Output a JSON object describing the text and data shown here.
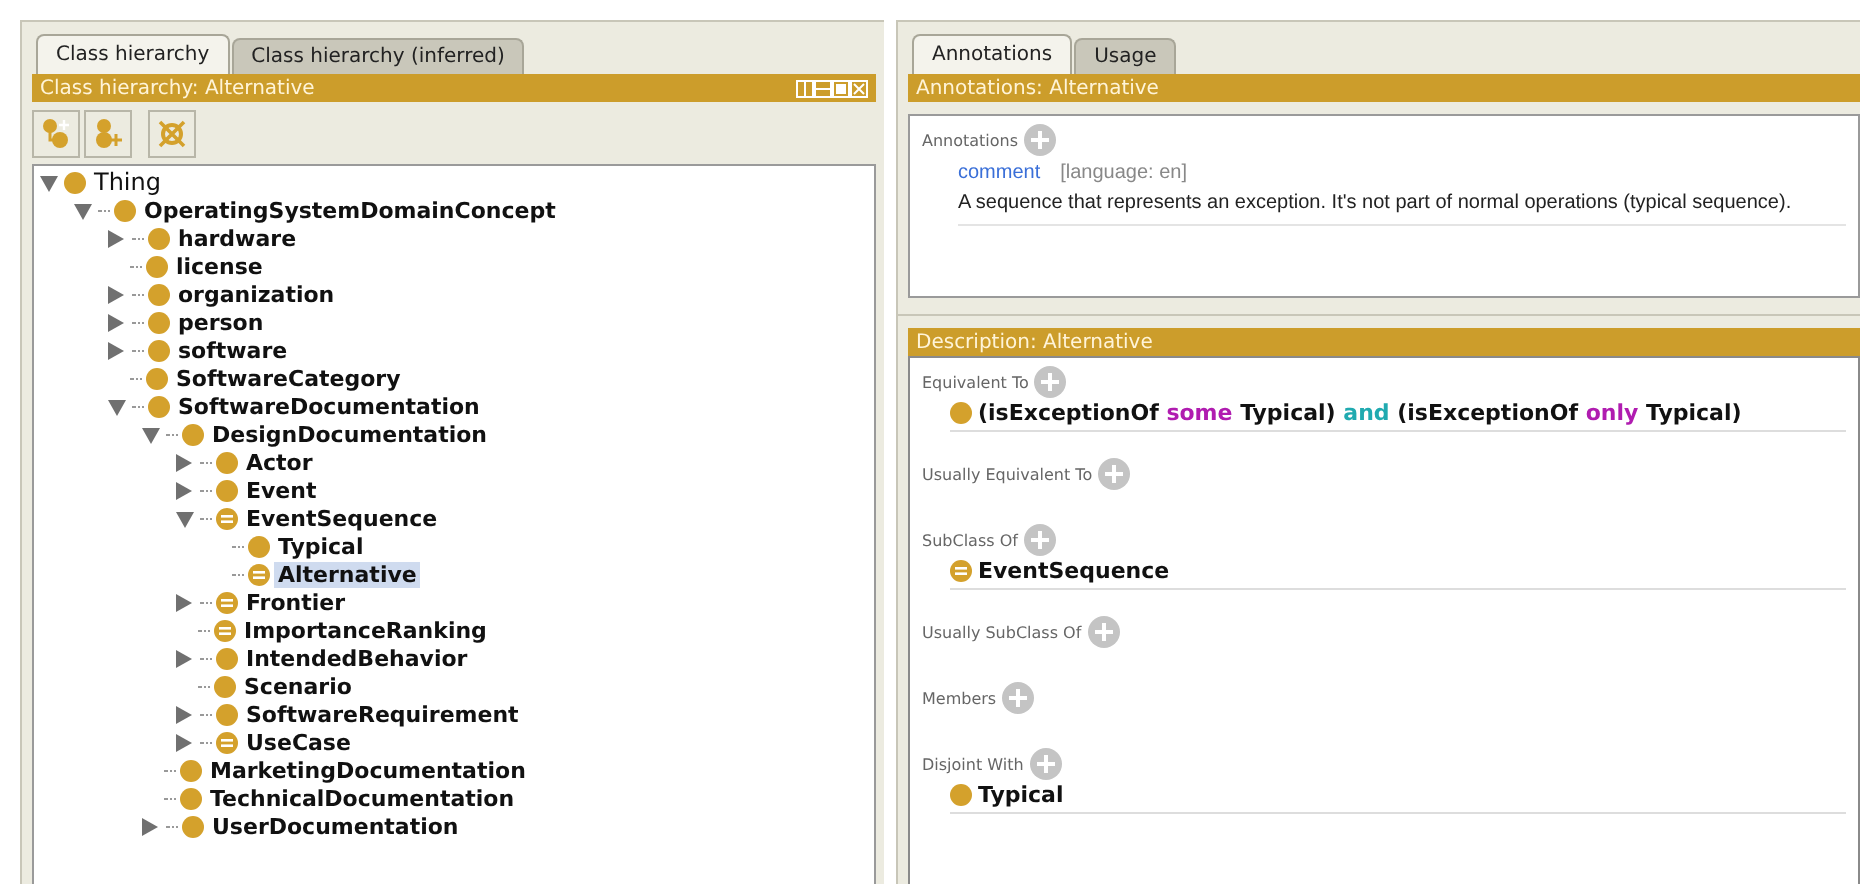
{
  "left_panel": {
    "tabs": [
      {
        "label": "Class hierarchy",
        "selected": true
      },
      {
        "label": "Class hierarchy (inferred)",
        "selected": false
      }
    ],
    "header": "Class hierarchy: Alternative",
    "tree": [
      {
        "label": "Thing",
        "kind": "primitive",
        "expandable": true,
        "expanded": true,
        "selected": false,
        "children": [
          {
            "label": "OperatingSystemDomainConcept",
            "kind": "primitive",
            "expandable": true,
            "expanded": true,
            "selected": false,
            "children": [
              {
                "label": "hardware",
                "kind": "primitive",
                "expandable": true,
                "expanded": false,
                "selected": false
              },
              {
                "label": "license",
                "kind": "primitive",
                "expandable": false,
                "selected": false
              },
              {
                "label": "organization",
                "kind": "primitive",
                "expandable": true,
                "expanded": false,
                "selected": false
              },
              {
                "label": "person",
                "kind": "primitive",
                "expandable": true,
                "expanded": false,
                "selected": false
              },
              {
                "label": "software",
                "kind": "primitive",
                "expandable": true,
                "expanded": false,
                "selected": false
              },
              {
                "label": "SoftwareCategory",
                "kind": "primitive",
                "expandable": false,
                "selected": false
              },
              {
                "label": "SoftwareDocumentation",
                "kind": "primitive",
                "expandable": true,
                "expanded": true,
                "selected": false,
                "children": [
                  {
                    "label": "DesignDocumentation",
                    "kind": "primitive",
                    "expandable": true,
                    "expanded": true,
                    "selected": false,
                    "children": [
                      {
                        "label": "Actor",
                        "kind": "primitive",
                        "expandable": true,
                        "expanded": false,
                        "selected": false
                      },
                      {
                        "label": "Event",
                        "kind": "primitive",
                        "expandable": true,
                        "expanded": false,
                        "selected": false
                      },
                      {
                        "label": "EventSequence",
                        "kind": "defined",
                        "expandable": true,
                        "expanded": true,
                        "selected": false,
                        "children": [
                          {
                            "label": "Typical",
                            "kind": "primitive",
                            "expandable": false,
                            "selected": false
                          },
                          {
                            "label": "Alternative",
                            "kind": "defined",
                            "expandable": false,
                            "selected": true
                          }
                        ]
                      },
                      {
                        "label": "Frontier",
                        "kind": "defined",
                        "expandable": true,
                        "expanded": false,
                        "selected": false
                      },
                      {
                        "label": "ImportanceRanking",
                        "kind": "defined",
                        "expandable": false,
                        "selected": false
                      },
                      {
                        "label": "IntendedBehavior",
                        "kind": "primitive",
                        "expandable": true,
                        "expanded": false,
                        "selected": false
                      },
                      {
                        "label": "Scenario",
                        "kind": "primitive",
                        "expandable": false,
                        "selected": false
                      },
                      {
                        "label": "SoftwareRequirement",
                        "kind": "primitive",
                        "expandable": true,
                        "expanded": false,
                        "selected": false
                      },
                      {
                        "label": "UseCase",
                        "kind": "defined",
                        "expandable": true,
                        "expanded": false,
                        "selected": false
                      }
                    ]
                  },
                  {
                    "label": "MarketingDocumentation",
                    "kind": "primitive",
                    "expandable": false,
                    "selected": false
                  },
                  {
                    "label": "TechnicalDocumentation",
                    "kind": "primitive",
                    "expandable": false,
                    "selected": false
                  },
                  {
                    "label": "UserDocumentation",
                    "kind": "primitive",
                    "expandable": true,
                    "expanded": false,
                    "selected": false
                  }
                ]
              }
            ]
          }
        ]
      }
    ]
  },
  "right_panel": {
    "tabs": [
      {
        "label": "Annotations",
        "selected": true
      },
      {
        "label": "Usage",
        "selected": false
      }
    ],
    "annotations": {
      "header": "Annotations: Alternative",
      "label": "Annotations",
      "items": [
        {
          "property": "comment",
          "language": "[language: en]",
          "value": "A sequence that represents an exception. It's not part of normal operations (typical sequence)."
        }
      ]
    },
    "description": {
      "header": "Description: Alternative",
      "sections": [
        {
          "label": "Equivalent To",
          "items": [
            {
              "kind": "primitive",
              "parts": [
                {
                  "kind": "text",
                  "text": "(isExceptionOf "
                },
                {
                  "kind": "keyword",
                  "text": "some"
                },
                {
                  "kind": "text",
                  "text": " Typical) "
                },
                {
                  "kind": "connective",
                  "text": "and"
                },
                {
                  "kind": "text",
                  "text": " (isExceptionOf "
                },
                {
                  "kind": "keyword",
                  "text": "only"
                },
                {
                  "kind": "text",
                  "text": " Typical)"
                }
              ]
            }
          ]
        },
        {
          "label": "Usually Equivalent To"
        },
        {
          "label": "SubClass Of",
          "items": [
            {
              "kind": "defined",
              "parts": [
                {
                  "kind": "text",
                  "text": "EventSequence"
                }
              ]
            }
          ]
        },
        {
          "label": "Usually SubClass Of"
        },
        {
          "label": "Members"
        },
        {
          "label": "Disjoint With",
          "items": [
            {
              "kind": "primitive",
              "parts": [
                {
                  "kind": "text",
                  "text": "Typical"
                }
              ]
            }
          ]
        }
      ]
    }
  }
}
